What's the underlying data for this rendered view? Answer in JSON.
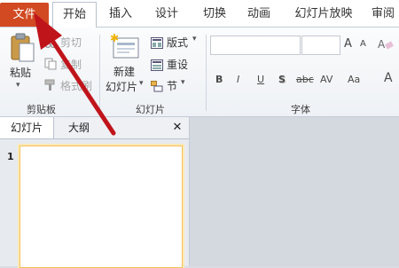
{
  "tabs": {
    "file": "文件",
    "items": [
      "开始",
      "插入",
      "设计",
      "切换",
      "动画",
      "幻灯片放映",
      "审阅"
    ]
  },
  "clipboard": {
    "paste": "粘贴",
    "cut": "剪切",
    "copy": "复制",
    "format_painter": "格式刷",
    "group": "剪贴板"
  },
  "slides": {
    "new_slide_line1": "新建",
    "new_slide_line2": "幻灯片",
    "layout": "版式",
    "reset": "重设",
    "section": "节",
    "group": "幻灯片"
  },
  "font": {
    "group": "字体",
    "bold": "B",
    "italic": "I",
    "underline": "U",
    "shadow": "S",
    "strikethrough": "abc",
    "spacing": "AV",
    "case": "Aa",
    "grow": "A",
    "shrink": "A",
    "color": "A"
  },
  "panel": {
    "tab_slides": "幻灯片",
    "tab_outline": "大纲",
    "close": "✕",
    "slide_number": "1"
  },
  "colors": {
    "file_tab": "#d14a22",
    "arrow": "#c0141b"
  }
}
